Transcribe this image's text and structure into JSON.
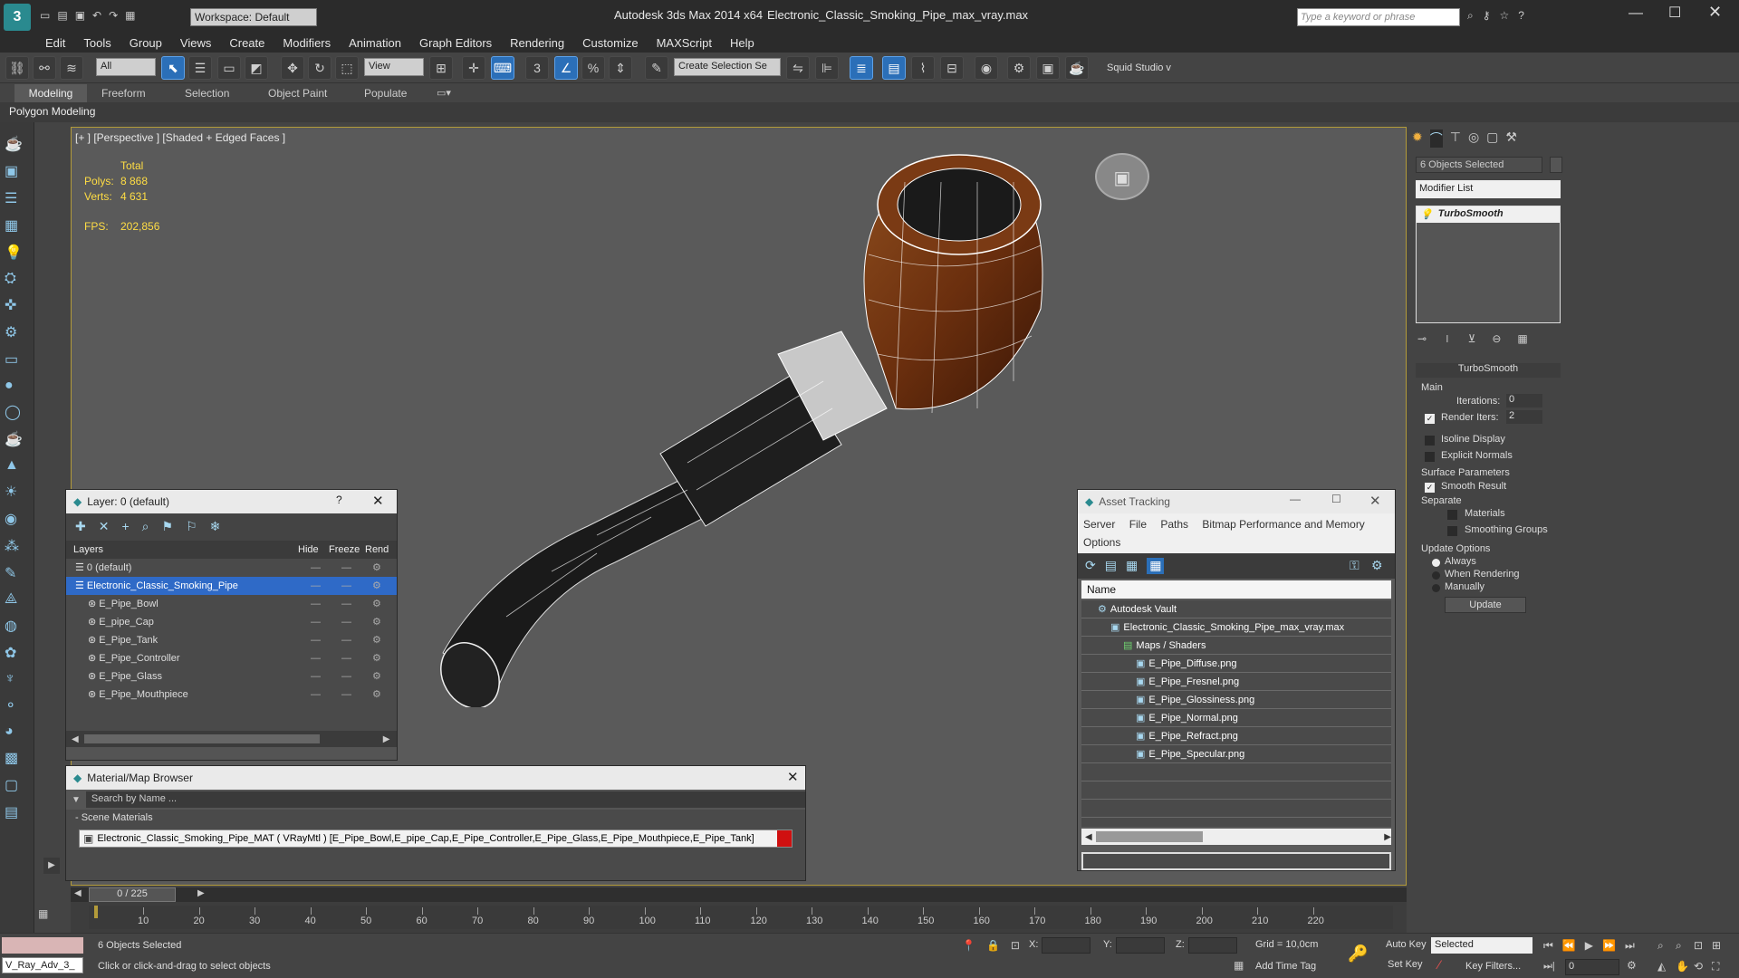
{
  "titlebar": {
    "app_title": "Autodesk 3ds Max  2014 x64",
    "file_title": "Electronic_Classic_Smoking_Pipe_max_vray.max",
    "workspace": "Workspace: Default",
    "search_placeholder": "Type a keyword or phrase"
  },
  "menu": [
    "Edit",
    "Tools",
    "Group",
    "Views",
    "Create",
    "Modifiers",
    "Animation",
    "Graph Editors",
    "Rendering",
    "Customize",
    "MAXScript",
    "Help"
  ],
  "mainbar": {
    "filter": "All",
    "refcoord": "View",
    "selection_set": "Create Selection Se",
    "studio": "Squid Studio v"
  },
  "ribbon": {
    "tabs": [
      "Modeling",
      "Freeform",
      "Selection",
      "Object Paint",
      "Populate"
    ],
    "sub_label": "Polygon Modeling"
  },
  "viewport": {
    "label": "[+ ] [Perspective ] [Shaded + Edged Faces ]",
    "stats_header": "Total",
    "polys_label": "Polys:",
    "polys_value": "8 868",
    "verts_label": "Verts:",
    "verts_value": "4 631",
    "fps_label": "FPS:",
    "fps_value": "202,856"
  },
  "layer_panel": {
    "title": "Layer: 0 (default)",
    "help": "?",
    "columns": [
      "Layers",
      "Hide",
      "Freeze",
      "Rend"
    ],
    "rows": [
      {
        "name": "0 (default)",
        "indent": 0
      },
      {
        "name": "Electronic_Classic_Smoking_Pipe",
        "indent": 0,
        "selected": true
      },
      {
        "name": "E_Pipe_Bowl",
        "indent": 1
      },
      {
        "name": "E_pipe_Cap",
        "indent": 1
      },
      {
        "name": "E_Pipe_Tank",
        "indent": 1
      },
      {
        "name": "E_Pipe_Controller",
        "indent": 1
      },
      {
        "name": "E_Pipe_Glass",
        "indent": 1
      },
      {
        "name": "E_Pipe_Mouthpiece",
        "indent": 1
      }
    ]
  },
  "material_browser": {
    "title": "Material/Map Browser",
    "search_placeholder": "Search by Name ...",
    "section": "- Scene Materials",
    "material": "Electronic_Classic_Smoking_Pipe_MAT ( VRayMtl ) [E_Pipe_Bowl,E_pipe_Cap,E_Pipe_Controller,E_Pipe_Glass,E_Pipe_Mouthpiece,E_Pipe_Tank]"
  },
  "asset_tracking": {
    "title": "Asset Tracking",
    "menus": [
      "Server",
      "File",
      "Paths",
      "Bitmap Performance and Memory",
      "Options"
    ],
    "column": "Name",
    "items": [
      {
        "name": "Autodesk Vault",
        "indent": 0
      },
      {
        "name": "Electronic_Classic_Smoking_Pipe_max_vray.max",
        "indent": 1
      },
      {
        "name": "Maps / Shaders",
        "indent": 2
      },
      {
        "name": "E_Pipe_Diffuse.png",
        "indent": 3
      },
      {
        "name": "E_Pipe_Fresnel.png",
        "indent": 3
      },
      {
        "name": "E_Pipe_Glossiness.png",
        "indent": 3
      },
      {
        "name": "E_Pipe_Normal.png",
        "indent": 3
      },
      {
        "name": "E_Pipe_Refract.png",
        "indent": 3
      },
      {
        "name": "E_Pipe_Specular.png",
        "indent": 3
      }
    ]
  },
  "command_panel": {
    "objects_selected": "6 Objects Selected",
    "modifier_list": "Modifier List",
    "stack_item": "TurboSmooth",
    "rollout_title": "TurboSmooth",
    "main_label": "Main",
    "iterations_label": "Iterations:",
    "iterations_value": "0",
    "render_iters_label": "Render Iters:",
    "render_iters_value": "2",
    "isoline": "Isoline Display",
    "explicit": "Explicit Normals",
    "surface_params": "Surface Parameters",
    "smooth_result": "Smooth Result",
    "separate": "Separate",
    "materials": "Materials",
    "smoothing_groups": "Smoothing Groups",
    "update_options": "Update Options",
    "always": "Always",
    "when_rendering": "When Rendering",
    "manually": "Manually",
    "update_button": "Update"
  },
  "timeline": {
    "frame_label": "0 / 225",
    "ticks": [
      "10",
      "20",
      "30",
      "40",
      "50",
      "60",
      "70",
      "80",
      "90",
      "100",
      "110",
      "120",
      "130",
      "140",
      "150",
      "160",
      "170",
      "180",
      "190",
      "200",
      "210",
      "220"
    ]
  },
  "status": {
    "script_label": "V_Ray_Adv_3_",
    "objects_selected": "6 Objects Selected",
    "hint": "Click or click-and-drag to select objects",
    "x_label": "X:",
    "y_label": "Y:",
    "z_label": "Z:",
    "grid": "Grid = 10,0cm",
    "add_time_tag": "Add Time Tag",
    "auto_key": "Auto Key",
    "set_key": "Set Key",
    "selected_dropdown": "Selected",
    "key_filters": "Key Filters...",
    "frame_value": "0"
  }
}
